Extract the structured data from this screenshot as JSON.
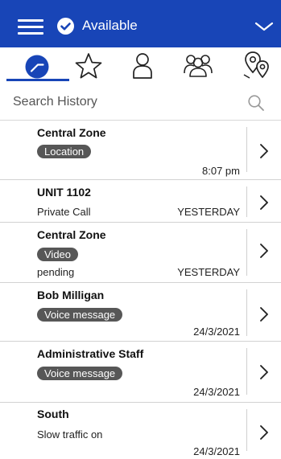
{
  "header": {
    "status": "Available"
  },
  "tabs": [
    {
      "id": "history",
      "icon": "clock-icon",
      "active": true
    },
    {
      "id": "favorites",
      "icon": "star-icon",
      "active": false
    },
    {
      "id": "contacts",
      "icon": "person-icon",
      "active": false
    },
    {
      "id": "groups",
      "icon": "group-icon",
      "active": false
    },
    {
      "id": "locations",
      "icon": "map-pins-icon",
      "active": false
    }
  ],
  "search": {
    "placeholder": "Search History"
  },
  "items": [
    {
      "title": "Central Zone",
      "badge": "Location",
      "subtitle": "",
      "time": "8:07 pm"
    },
    {
      "title": "UNIT 1102",
      "badge": "",
      "subtitle": "Private Call",
      "time": "YESTERDAY"
    },
    {
      "title": "Central Zone",
      "badge": "Video",
      "subtitle": "pending",
      "time": "YESTERDAY"
    },
    {
      "title": "Bob Milligan",
      "badge": "Voice message",
      "subtitle": "",
      "time": "24/3/2021"
    },
    {
      "title": "Administrative Staff",
      "badge": "Voice message",
      "subtitle": "",
      "time": "24/3/2021"
    },
    {
      "title": "South",
      "badge": "",
      "subtitle": "Slow traffic on",
      "time": "24/3/2021"
    }
  ],
  "colors": {
    "brand": "#1845b7",
    "badge": "#575757"
  }
}
